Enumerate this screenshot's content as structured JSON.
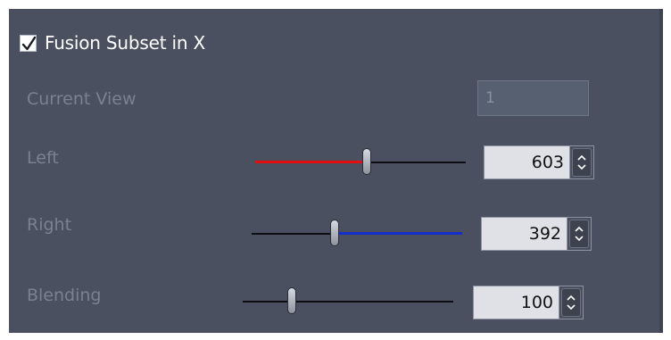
{
  "header": {
    "label": "Fusion Subset in X",
    "checked": true
  },
  "current_view": {
    "label": "Current View",
    "value": "1"
  },
  "left": {
    "label": "Left",
    "value": "603",
    "slider_fraction": 0.53,
    "fill_color": "#e01010"
  },
  "right": {
    "label": "Right",
    "value": "392",
    "slider_fraction": 0.39,
    "fill_color": "#1530c8"
  },
  "blending": {
    "label": "Blending",
    "value": "100",
    "slider_fraction": 0.22
  },
  "colors": {
    "panel_bg": "#4a505f",
    "label_text": "#7b8191",
    "header_text": "#ffffff"
  }
}
